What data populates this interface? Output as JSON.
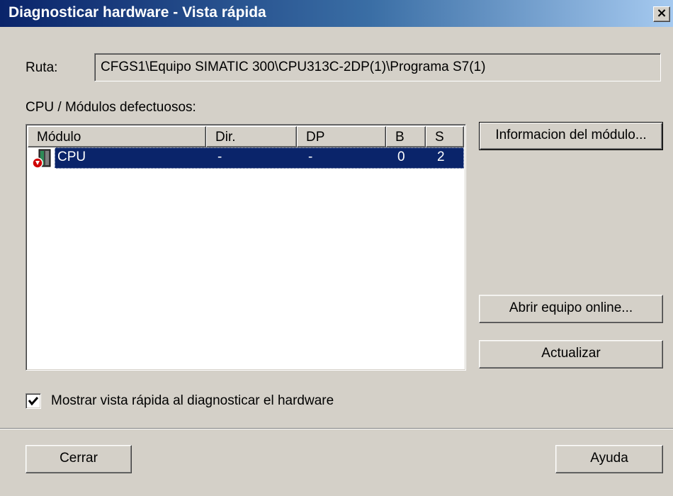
{
  "window": {
    "title": "Diagnosticar hardware - Vista rápida",
    "close_glyph": "×"
  },
  "path": {
    "label": "Ruta:",
    "value": "CFGS1\\Equipo SIMATIC 300\\CPU313C-2DP(1)\\Programa S7(1)"
  },
  "modules": {
    "label": "CPU / Módulos defectuosos:",
    "columns": [
      "Módulo",
      "Dir.",
      "DP",
      "B",
      "S"
    ],
    "rows": [
      {
        "icon": "cpu-fault-icon",
        "module": "CPU",
        "dir": "-",
        "dp": "-",
        "b": "0",
        "s": "2",
        "selected": true
      }
    ]
  },
  "buttons": {
    "module_info": "Informacion del módulo...",
    "open_online": "Abrir equipo online...",
    "update": "Actualizar",
    "close": "Cerrar",
    "help": "Ayuda"
  },
  "options": {
    "show_quick_view_label": "Mostrar vista rápida al diagnosticar el hardware",
    "show_quick_view_checked": true
  },
  "colors": {
    "selection": "#0a246a",
    "dialog_face": "#d4d0c8",
    "title_gradient_start": "#0a246a",
    "fault_icon": "#d00000"
  }
}
